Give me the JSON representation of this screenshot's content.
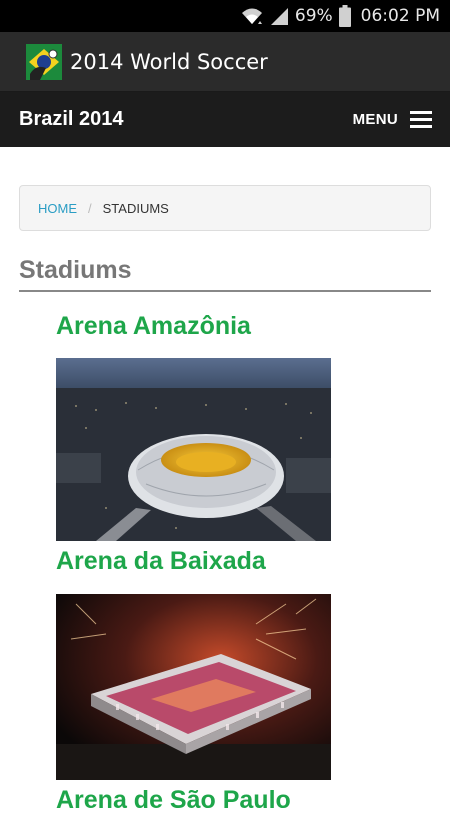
{
  "status_bar": {
    "battery_percent": "69%",
    "time": "06:02 PM",
    "icons": [
      "wifi-icon",
      "signal-icon",
      "battery-icon"
    ]
  },
  "app_bar": {
    "title": "2014 World Soccer",
    "icon": "app-logo-icon"
  },
  "site_header": {
    "brand": "Brazil 2014",
    "menu_label": "MENU",
    "menu_icon": "hamburger-menu-icon"
  },
  "breadcrumb": {
    "home": "HOME",
    "separator": "/",
    "current": "STADIUMS"
  },
  "page": {
    "title": "Stadiums"
  },
  "stadiums": [
    {
      "name": "Arena Amazônia",
      "photo": "arena-amazonia-photo"
    },
    {
      "name": "Arena da Baixada",
      "photo": "arena-da-baixada-photo"
    },
    {
      "name": "Arena de São Paulo",
      "photo": ""
    }
  ],
  "colors": {
    "link_green": "#1ea64a",
    "breadcrumb_link": "#2a9dc4",
    "header_bg": "#1c1c1c",
    "app_bar_bg": "#2b2b2b"
  }
}
